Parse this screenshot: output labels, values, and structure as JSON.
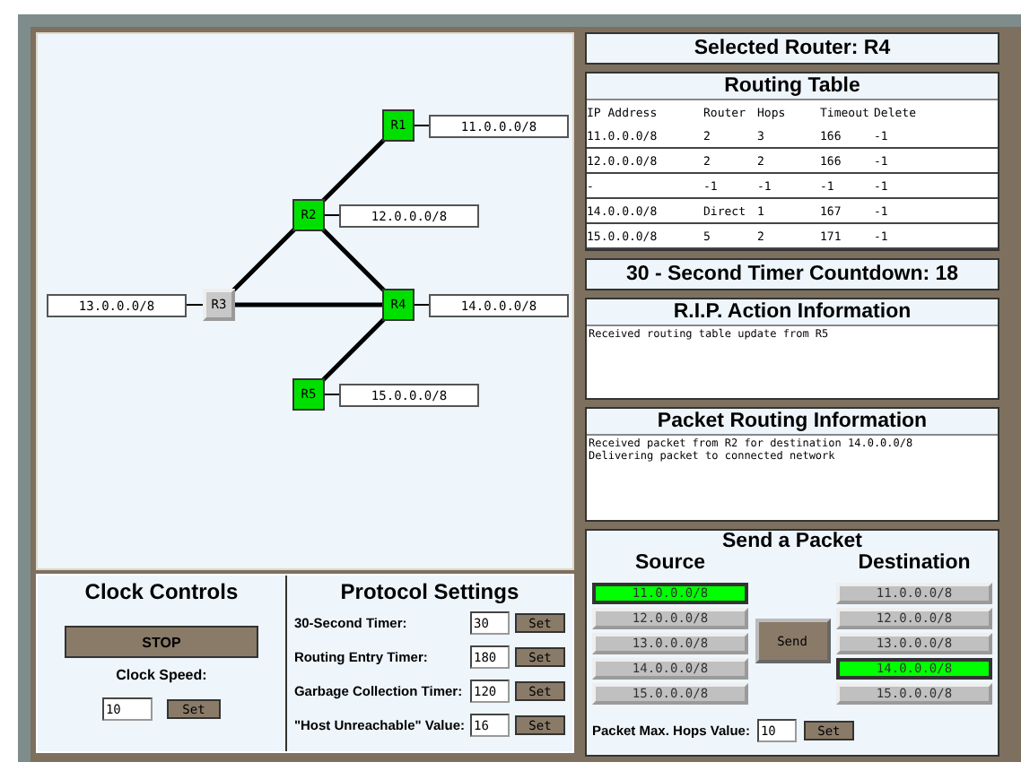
{
  "network_diagram": {
    "routers": [
      {
        "label": "R1",
        "network": "11.0.0.0/8",
        "active": true
      },
      {
        "label": "R2",
        "network": "12.0.0.0/8",
        "active": true
      },
      {
        "label": "R3",
        "network": "13.0.0.0/8",
        "active": false
      },
      {
        "label": "R4",
        "network": "14.0.0.0/8",
        "active": true
      },
      {
        "label": "R5",
        "network": "15.0.0.0/8",
        "active": true
      }
    ]
  },
  "selected_router": {
    "title": "Selected Router: R4"
  },
  "routing_table": {
    "title": "Routing Table",
    "columns": [
      "IP Address",
      "Router",
      "Hops",
      "Timeout",
      "Delete"
    ],
    "rows": [
      [
        "11.0.0.0/8",
        "2",
        "3",
        "166",
        "-1"
      ],
      [
        "12.0.0.0/8",
        "2",
        "2",
        "166",
        "-1"
      ],
      [
        "-",
        "-1",
        "-1",
        "-1",
        "-1"
      ],
      [
        "14.0.0.0/8",
        "Direct",
        "1",
        "167",
        "-1"
      ],
      [
        "15.0.0.0/8",
        "5",
        "2",
        "171",
        "-1"
      ]
    ]
  },
  "countdown": {
    "title": "30 - Second Timer Countdown: 18"
  },
  "rip_action": {
    "title": "R.I.P. Action Information",
    "lines": [
      "Received routing table update from R5"
    ]
  },
  "packet_routing": {
    "title": "Packet Routing Information",
    "lines": [
      "Received packet from R2 for destination 14.0.0.0/8",
      "Delivering packet to connected network"
    ]
  },
  "clock_controls": {
    "title": "Clock Controls",
    "stop_button": "STOP",
    "speed_label": "Clock Speed:",
    "speed_value": "10",
    "set_button": "Set"
  },
  "protocol_settings": {
    "title": "Protocol Settings",
    "settings": [
      {
        "label": "30-Second Timer:",
        "value": "30",
        "button": "Set"
      },
      {
        "label": "Routing Entry Timer:",
        "value": "180",
        "button": "Set"
      },
      {
        "label": "Garbage Collection Timer:",
        "value": "120",
        "button": "Set"
      },
      {
        "label": "\"Host Unreachable\" Value:",
        "value": "16",
        "button": "Set"
      }
    ]
  },
  "send_packet": {
    "title": "Send a Packet",
    "source_heading": "Source",
    "destination_heading": "Destination",
    "sources": [
      {
        "label": "11.0.0.0/8",
        "selected": true
      },
      {
        "label": "12.0.0.0/8",
        "selected": false
      },
      {
        "label": "13.0.0.0/8",
        "selected": false
      },
      {
        "label": "14.0.0.0/8",
        "selected": false
      },
      {
        "label": "15.0.0.0/8",
        "selected": false
      }
    ],
    "destinations": [
      {
        "label": "11.0.0.0/8",
        "selected": false
      },
      {
        "label": "12.0.0.0/8",
        "selected": false
      },
      {
        "label": "13.0.0.0/8",
        "selected": false
      },
      {
        "label": "14.0.0.0/8",
        "selected": true
      },
      {
        "label": "15.0.0.0/8",
        "selected": false
      }
    ],
    "send_button": "Send",
    "max_hops_label": "Packet Max. Hops Value:",
    "max_hops_value": "10",
    "set_button": "Set"
  }
}
